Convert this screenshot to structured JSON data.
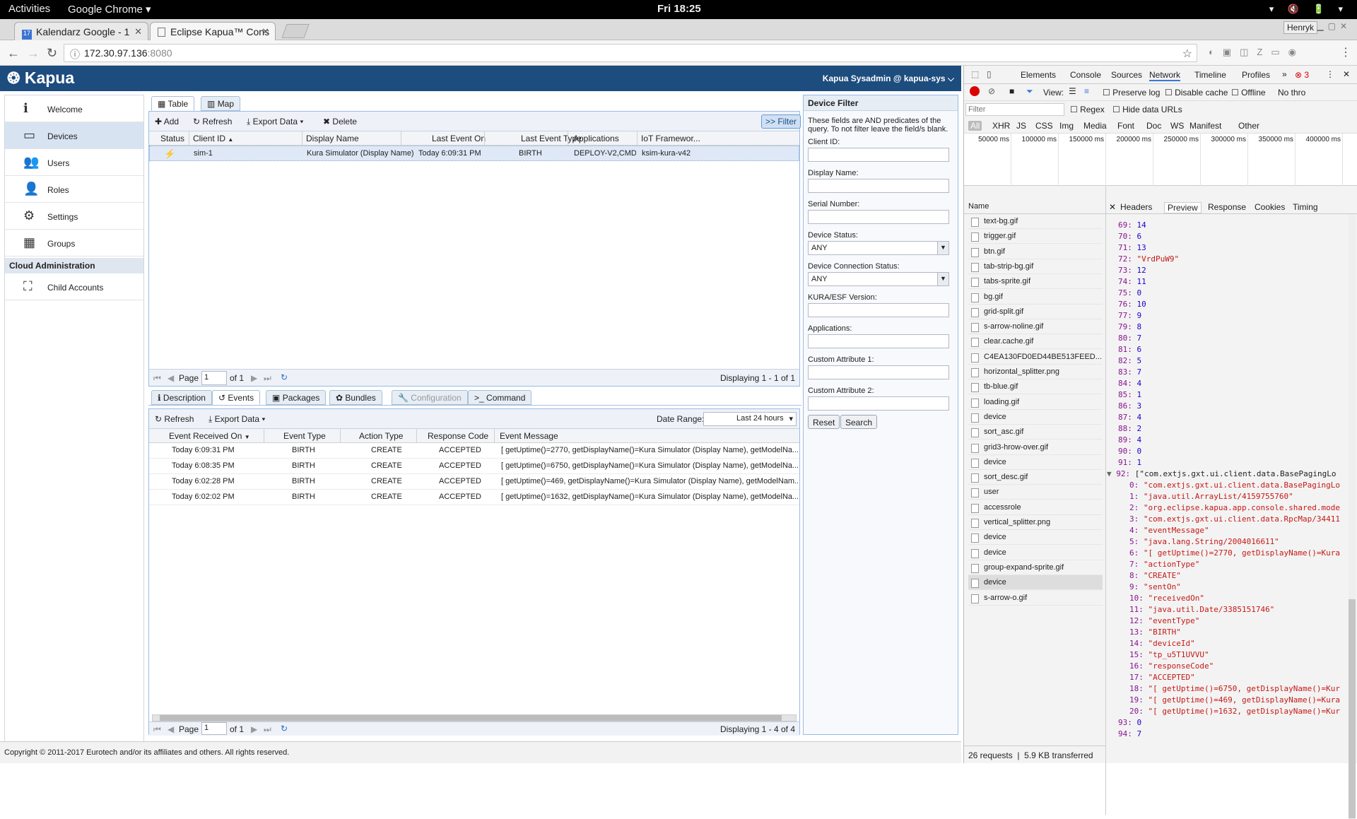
{
  "gnome": {
    "activities": "Activities",
    "app": "Google Chrome ▾",
    "clock": "Fri 18:25"
  },
  "chrome": {
    "tabs": [
      {
        "label": "Kalendarz Google - 1"
      },
      {
        "label": "Eclipse Kapua™ Cons"
      }
    ],
    "url_host": "172.30.97.136",
    "url_port": ":8080",
    "profile": "Henryk"
  },
  "kapua": {
    "logo": "Kapua",
    "user": "Kapua Sysadmin @ kapua-sys ⌵"
  },
  "sidebar": {
    "items": [
      {
        "label": "Welcome",
        "icon": "ℹ"
      },
      {
        "label": "Devices",
        "icon": "▭"
      },
      {
        "label": "Users",
        "icon": "👥"
      },
      {
        "label": "Roles",
        "icon": "👤"
      },
      {
        "label": "Settings",
        "icon": "⚙"
      },
      {
        "label": "Groups",
        "icon": "▦"
      }
    ],
    "section": "Cloud Administration",
    "section_items": [
      {
        "label": "Child Accounts",
        "icon": "⛶"
      }
    ]
  },
  "device_tabs": {
    "table": "Table",
    "map": "Map"
  },
  "device_toolbar": {
    "add": "Add",
    "refresh": "Refresh",
    "export": "Export Data",
    "delete": "Delete",
    "filter": ">> Filter"
  },
  "device_columns": [
    "Status",
    "Client ID",
    "Display Name",
    "Last Event On",
    "Last Event Type",
    "Applications",
    "IoT Framewor..."
  ],
  "devices": [
    {
      "client_id": "sim-1",
      "display_name": "Kura Simulator (Display Name)",
      "last_event_on": "Today 6:09:31 PM",
      "last_event_type": "BIRTH",
      "applications": "DEPLOY-V2,CMD-...",
      "framework": "ksim-kura-v42"
    }
  ],
  "pager_top": {
    "page_label": "Page",
    "page": "1",
    "of": "of 1",
    "displaying": "Displaying 1 - 1 of 1"
  },
  "detail_tabs": [
    "Description",
    "Events",
    "Packages",
    "Bundles",
    "Configuration",
    "Command"
  ],
  "events_toolbar": {
    "refresh": "Refresh",
    "export": "Export Data",
    "date_range_label": "Date Range:",
    "date_range": "Last 24 hours"
  },
  "event_columns": [
    "Event Received On",
    "Event Type",
    "Action Type",
    "Response Code",
    "Event Message"
  ],
  "events": [
    {
      "received": "Today 6:09:31 PM",
      "type": "BIRTH",
      "action": "CREATE",
      "code": "ACCEPTED",
      "message": "[ getUptime()=2770, getDisplayName()=Kura Simulator (Display Name), getModelNa..."
    },
    {
      "received": "Today 6:08:35 PM",
      "type": "BIRTH",
      "action": "CREATE",
      "code": "ACCEPTED",
      "message": "[ getUptime()=6750, getDisplayName()=Kura Simulator (Display Name), getModelNa..."
    },
    {
      "received": "Today 6:02:28 PM",
      "type": "BIRTH",
      "action": "CREATE",
      "code": "ACCEPTED",
      "message": "[ getUptime()=469, getDisplayName()=Kura Simulator (Display Name), getModelNam..."
    },
    {
      "received": "Today 6:02:02 PM",
      "type": "BIRTH",
      "action": "CREATE",
      "code": "ACCEPTED",
      "message": "[ getUptime()=1632, getDisplayName()=Kura Simulator (Display Name), getModelNa..."
    }
  ],
  "pager_bottom": {
    "page_label": "Page",
    "page": "1",
    "of": "of 1",
    "displaying": "Displaying 1 - 4 of 4"
  },
  "filter": {
    "title": "Device Filter",
    "desc": "These fields are AND predicates of the query. To not filter leave the field/s blank.",
    "client_id": "Client ID:",
    "display_name": "Display Name:",
    "serial": "Serial Number:",
    "status": "Device Status:",
    "status_value": "ANY",
    "conn": "Device Connection Status:",
    "conn_value": "ANY",
    "kura": "KURA/ESF Version:",
    "apps": "Applications:",
    "ca1": "Custom Attribute 1:",
    "ca2": "Custom Attribute 2:",
    "reset": "Reset",
    "search": "Search"
  },
  "footer": {
    "copyright": "Copyright © 2011-2017 Eurotech and/or its affiliates and others. All rights reserved."
  },
  "devtools": {
    "tabs": [
      "Elements",
      "Console",
      "Sources",
      "Network",
      "Timeline",
      "Profiles"
    ],
    "error_count": "3",
    "view": "View:",
    "preserve": "Preserve log",
    "disable_cache": "Disable cache",
    "offline": "Offline",
    "throttle": "No thro",
    "filter_placeholder": "Filter",
    "regex": "Regex",
    "hide_data": "Hide data URLs",
    "types": [
      "All",
      "XHR",
      "JS",
      "CSS",
      "Img",
      "Media",
      "Font",
      "Doc",
      "WS",
      "Manifest",
      "Other"
    ],
    "timeline": [
      "50000 ms",
      "100000 ms",
      "150000 ms",
      "200000 ms",
      "250000 ms",
      "300000 ms",
      "350000 ms",
      "400000 ms"
    ],
    "name_header": "Name",
    "files": [
      "text-bg.gif",
      "trigger.gif",
      "btn.gif",
      "tab-strip-bg.gif",
      "tabs-sprite.gif",
      "bg.gif",
      "grid-split.gif",
      "s-arrow-noline.gif",
      "clear.cache.gif",
      "C4EA130FD0ED44BE513FEED...",
      "horizontal_splitter.png",
      "tb-blue.gif",
      "loading.gif",
      "device",
      "sort_asc.gif",
      "grid3-hrow-over.gif",
      "device",
      "sort_desc.gif",
      "user",
      "accessrole",
      "vertical_splitter.png",
      "device",
      "device",
      "group-expand-sprite.gif",
      "device",
      "s-arrow-o.gif"
    ],
    "detail_tabs": [
      "Headers",
      "Preview",
      "Response",
      "Cookies",
      "Timing"
    ],
    "preview": [
      [
        "69:",
        "14",
        "n"
      ],
      [
        "70:",
        "6",
        "n"
      ],
      [
        "71:",
        "13",
        "n"
      ],
      [
        "72:",
        "\"VrdPuW9\"",
        "s"
      ],
      [
        "73:",
        "12",
        "n"
      ],
      [
        "74:",
        "11",
        "n"
      ],
      [
        "75:",
        "0",
        "n"
      ],
      [
        "76:",
        "10",
        "n"
      ],
      [
        "77:",
        "9",
        "n"
      ],
      [
        "79:",
        "8",
        "n"
      ],
      [
        "80:",
        "7",
        "n"
      ],
      [
        "81:",
        "6",
        "n"
      ],
      [
        "82:",
        "5",
        "n"
      ],
      [
        "83:",
        "7",
        "n"
      ],
      [
        "84:",
        "4",
        "n"
      ],
      [
        "85:",
        "1",
        "n"
      ],
      [
        "86:",
        "3",
        "n"
      ],
      [
        "87:",
        "4",
        "n"
      ],
      [
        "88:",
        "2",
        "n"
      ],
      [
        "89:",
        "4",
        "n"
      ],
      [
        "90:",
        "0",
        "n"
      ],
      [
        "91:",
        "1",
        "n"
      ],
      [
        "92:",
        "[\"com.extjs.gxt.ui.client.data.BasePagingLo",
        "x"
      ],
      [
        "0:",
        "\"com.extjs.gxt.ui.client.data.BasePagingLo",
        "s"
      ],
      [
        "1:",
        "\"java.util.ArrayList/4159755760\"",
        "s"
      ],
      [
        "2:",
        "\"org.eclipse.kapua.app.console.shared.mode",
        "s"
      ],
      [
        "3:",
        "\"com.extjs.gxt.ui.client.data.RpcMap/34411",
        "s"
      ],
      [
        "4:",
        "\"eventMessage\"",
        "s"
      ],
      [
        "5:",
        "\"java.lang.String/2004016611\"",
        "s"
      ],
      [
        "6:",
        "\"[ getUptime()=2770, getDisplayName()=Kura",
        "s"
      ],
      [
        "7:",
        "\"actionType\"",
        "s"
      ],
      [
        "8:",
        "\"CREATE\"",
        "s"
      ],
      [
        "9:",
        "\"sentOn\"",
        "s"
      ],
      [
        "10:",
        "\"receivedOn\"",
        "s"
      ],
      [
        "11:",
        "\"java.util.Date/3385151746\"",
        "s"
      ],
      [
        "12:",
        "\"eventType\"",
        "s"
      ],
      [
        "13:",
        "\"BIRTH\"",
        "s"
      ],
      [
        "14:",
        "\"deviceId\"",
        "s"
      ],
      [
        "15:",
        "\"tp_u5T1UVVU\"",
        "s"
      ],
      [
        "16:",
        "\"responseCode\"",
        "s"
      ],
      [
        "17:",
        "\"ACCEPTED\"",
        "s"
      ],
      [
        "18:",
        "\"[ getUptime()=6750, getDisplayName()=Kur",
        "s"
      ],
      [
        "19:",
        "\"[ getUptime()=469, getDisplayName()=Kura",
        "s"
      ],
      [
        "20:",
        "\"[ getUptime()=1632, getDisplayName()=Kur",
        "s"
      ],
      [
        "93:",
        "0",
        "n"
      ],
      [
        "94:",
        "7",
        "n"
      ]
    ],
    "status": "26 requests  |  5.9 KB transferred"
  }
}
